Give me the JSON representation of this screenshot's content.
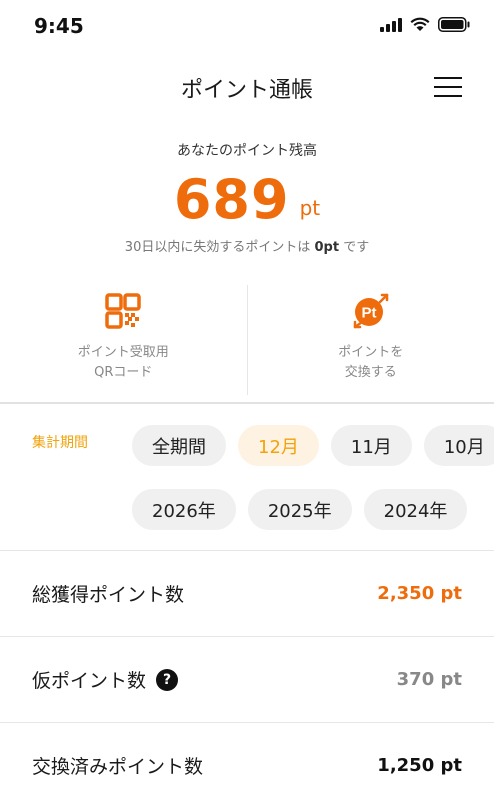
{
  "status_bar": {
    "time": "9:45"
  },
  "header": {
    "title": "ポイント通帳"
  },
  "balance": {
    "label": "あなたのポイント残高",
    "value": "689",
    "unit": "pt",
    "expire_prefix": "30日以内に失効するポイントは ",
    "expire_value": "0pt",
    "expire_suffix": " です"
  },
  "actions": [
    {
      "label": "ポイント受取用\nQRコード",
      "icon": "qr-code-icon"
    },
    {
      "label": "ポイントを\n交換する",
      "icon": "pt-exchange-icon"
    }
  ],
  "period": {
    "label": "集計期間",
    "months": [
      "全期間",
      "12月",
      "11月",
      "10月"
    ],
    "selected_month": "12月",
    "years": [
      "2026年",
      "2025年",
      "2024年"
    ]
  },
  "stats": [
    {
      "label": "総獲得ポイント数",
      "value": "2,350 pt",
      "color": "#ee6c0c"
    },
    {
      "label": "仮ポイント数",
      "value": "370 pt",
      "color": "#888888",
      "help_icon": "question-icon"
    },
    {
      "label": "交換済みポイント数",
      "value": "1,250 pt",
      "color": "#111111"
    }
  ],
  "colors": {
    "accent": "#ee6c0c",
    "period_accent": "#f2a20a"
  }
}
